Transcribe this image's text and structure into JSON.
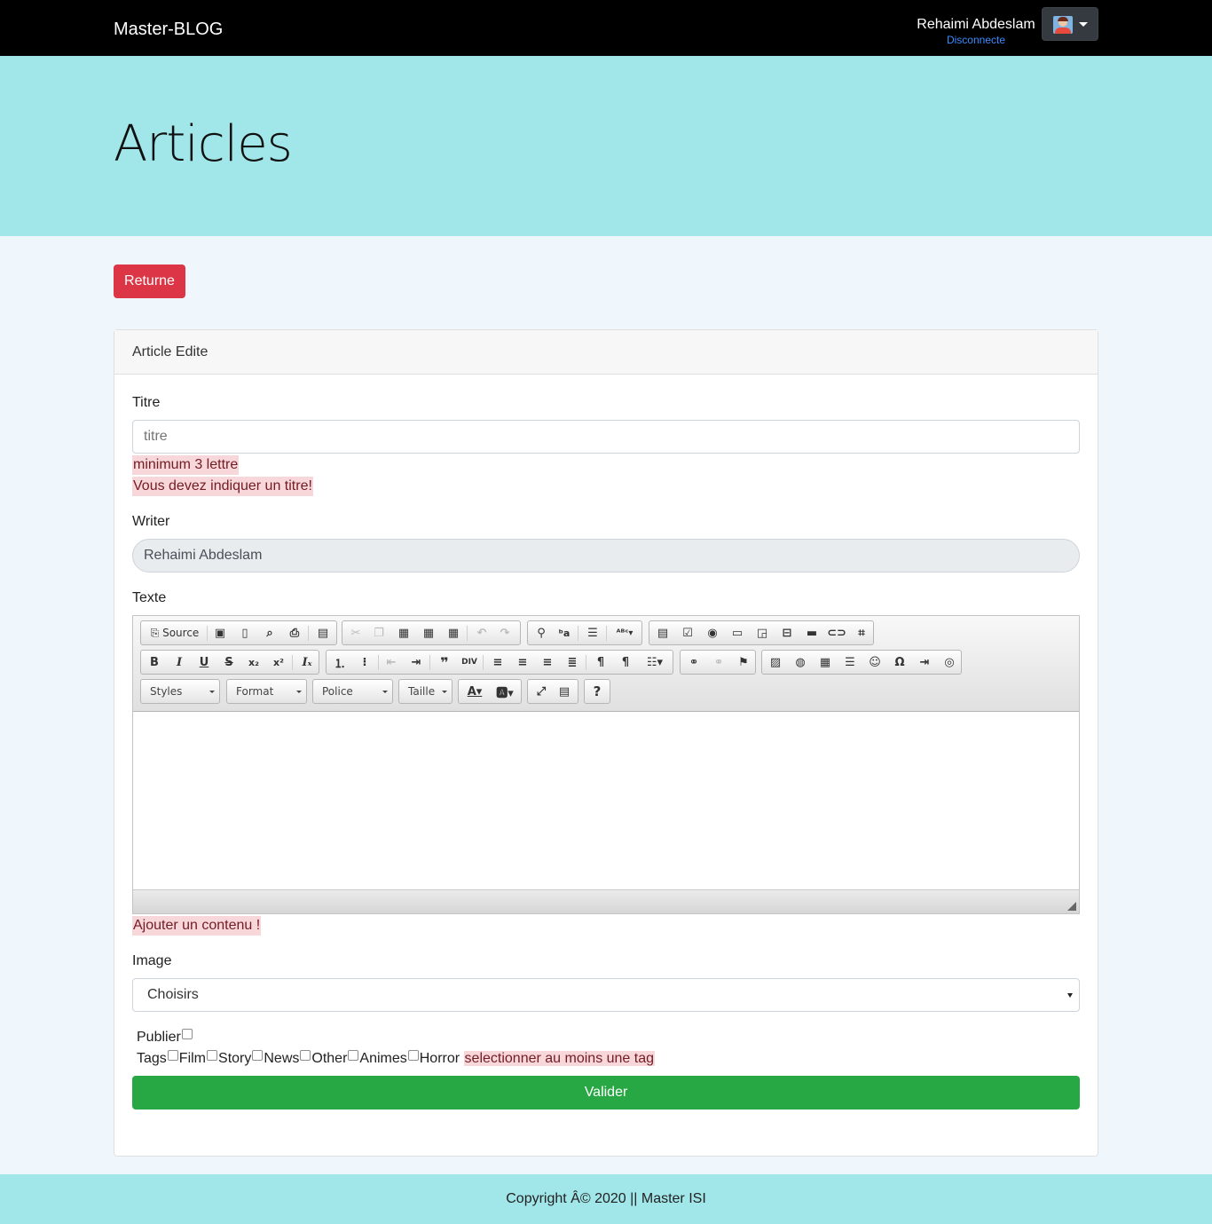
{
  "navbar": {
    "brand": "Master-BLOG",
    "user_name": "Rehaimi Abdeslam",
    "logout": "Disconnecte"
  },
  "hero": {
    "title": "Articles"
  },
  "back_button": "Returne",
  "card": {
    "header": "Article Edite",
    "title_label": "Titre",
    "title_placeholder": "titre",
    "title_errors": [
      "minimum 3 lettre",
      "Vous devez indiquer un titre!"
    ],
    "writer_label": "Writer",
    "writer_value": "Rehaimi Abdeslam",
    "text_label": "Texte",
    "editor": {
      "source_label": "Source",
      "combos": [
        "Styles",
        "Format",
        "Police",
        "Taille"
      ],
      "help": "?"
    },
    "text_error": "Ajouter un contenu !",
    "image_label": "Image",
    "image_select": "Choisirs",
    "publish_label": "Publier",
    "tags_label": "Tags",
    "tags": [
      "Film",
      "Story",
      "News",
      "Other",
      "Animes",
      "Horror"
    ],
    "tags_error": "selectionner au moins une tag",
    "submit": "Valider"
  },
  "footer": {
    "text": "Copyright Â© 2020 || Master ISI"
  },
  "colors": {
    "navbar": "#000000",
    "hero": "#a1e6e9",
    "page_bg": "#eff6fc",
    "danger": "#dc3545",
    "success": "#28a745",
    "error_bg": "#f8d7da",
    "link": "#3b8cff"
  }
}
